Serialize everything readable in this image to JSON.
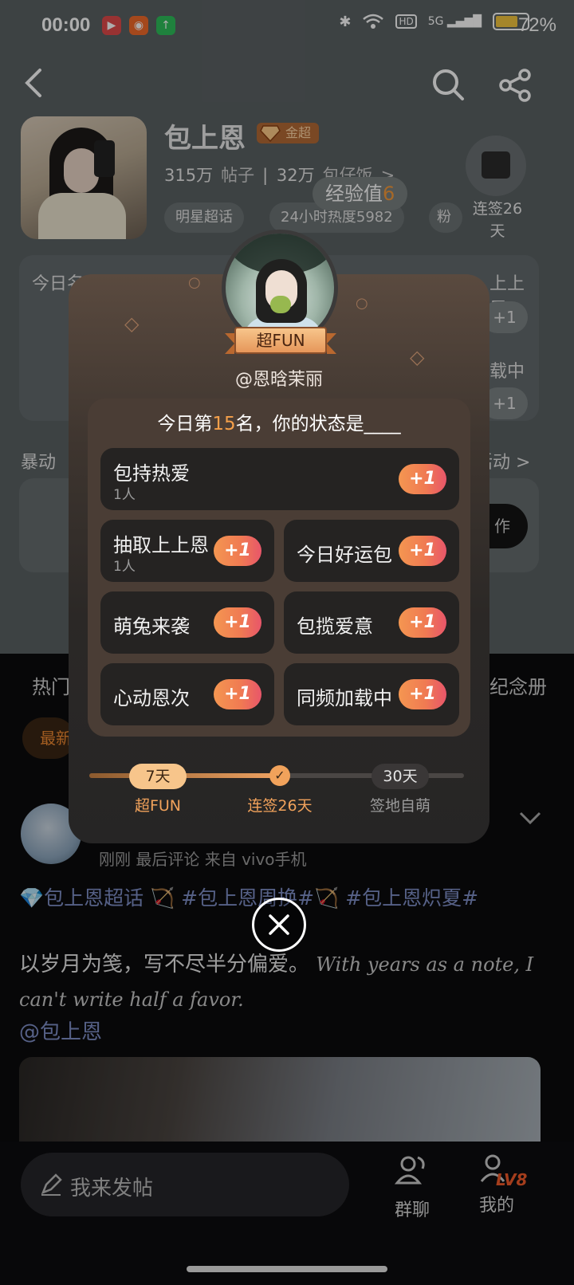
{
  "status_bar": {
    "time": "00:00",
    "battery_percent": "72%",
    "battery_level": 0.72,
    "icons": [
      "video-app-icon",
      "kuaishou-app-icon",
      "upload-app-icon",
      "bluetooth-icon",
      "wifi-icon",
      "hd-icon",
      "signal-5g-icon",
      "battery-icon"
    ],
    "hd_label": "HD",
    "network_label": "5G"
  },
  "header": {
    "name": "包上恩",
    "badge": "金超",
    "stats": {
      "posts": "315万",
      "posts_label": "帖子",
      "fans": "32万",
      "fans_label": "包仔饭",
      "arrow": ">"
    },
    "tags": [
      "明星超话",
      "24小时热度5982",
      "粉"
    ],
    "exp_label": "经验值",
    "exp_value": "6",
    "checkin_text": "连签26天"
  },
  "rank_card": {
    "left_label": "今日名",
    "right_name": "上上恩",
    "right_item": "载中",
    "plus_label": "+1"
  },
  "activity": {
    "title": "暴动",
    "more": "活动 >",
    "button": "作"
  },
  "feed_tabs": {
    "left": "热门",
    "right": "纪念册"
  },
  "filter_chip": "最新",
  "post": {
    "meta": "刚刚 最后评论  来自 vivo手机",
    "tags": "💎包上恩超话  🏹 #包上恩周换#🏹 #包上恩炽夏#",
    "body_cn": "以岁月为笺，写不尽半分偏爱。",
    "body_en": "With years as a note, I can't write half a favor.",
    "mention": "@包上恩"
  },
  "bottom_nav": {
    "composer_placeholder": "我来发帖",
    "group_chat": "群聊",
    "mine": "我的",
    "level": "LV8"
  },
  "modal": {
    "badge": "超FUN",
    "handle": "@恩晗茉丽",
    "question_prefix": "今日第",
    "rank": "15",
    "question_suffix": "名，你的状态是____",
    "options": [
      {
        "label": "包持热爱",
        "count": "1人",
        "plus": "+1"
      },
      {
        "label": "抽取上上恩",
        "count": "1人",
        "plus": "+1"
      },
      {
        "label": "今日好运包",
        "count": "",
        "plus": "+1"
      },
      {
        "label": "萌兔来袭",
        "count": "",
        "plus": "+1"
      },
      {
        "label": "包揽爱意",
        "count": "",
        "plus": "+1"
      },
      {
        "label": "心动恩次",
        "count": "",
        "plus": "+1"
      },
      {
        "label": "同频加载中",
        "count": "",
        "plus": "+1"
      }
    ],
    "progress": {
      "steps": [
        {
          "pill": "7天",
          "label": "超FUN"
        },
        {
          "pill": "✓",
          "label": "连签26天"
        },
        {
          "pill": "30天",
          "label": "签地自萌"
        }
      ],
      "current_day": 26,
      "max_day": 30
    },
    "colors": {
      "accent": "#f5a04a",
      "plus_start": "#f49651",
      "plus_end": "#e8566a"
    }
  }
}
